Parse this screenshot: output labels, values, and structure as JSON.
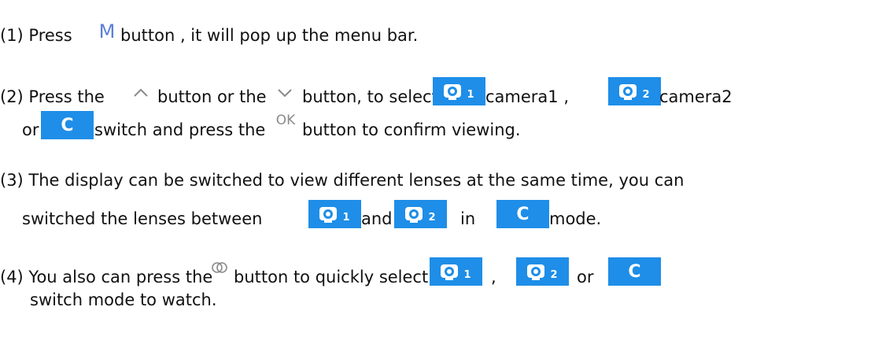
{
  "colors": {
    "accent_blue": "#1e8ee8",
    "icon_gray": "#8a8a8a",
    "menu_icon_color": "#5b7fd8",
    "text": "#111111"
  },
  "step1": {
    "prefix": "(1) Press",
    "menu_icon": "M",
    "suffix": "button , it will pop up the menu bar."
  },
  "step2": {
    "prefix": "(2) Press the",
    "mid1": "button or the",
    "mid2": "button, to select",
    "camera1_label": "camera1 ,",
    "camera2_label": "camera2",
    "or_text": "or",
    "switch_text": "switch and press the",
    "ok_icon": "OK",
    "confirm_text": "button to confirm viewing."
  },
  "step3": {
    "line1": "(3) The display can be switched to view different lenses at the same time, you can",
    "prefix": "switched the lenses between",
    "and_text": "and",
    "in_text": "in",
    "mode_text": "mode."
  },
  "step4": {
    "prefix": "(4) You also can press the",
    "mid": "button to quickly select",
    "comma": ",",
    "or_text": "or",
    "line2": "switch mode to watch."
  },
  "icons": {
    "camera1_number": "1",
    "camera2_number": "2",
    "switch_symbol": "C"
  }
}
